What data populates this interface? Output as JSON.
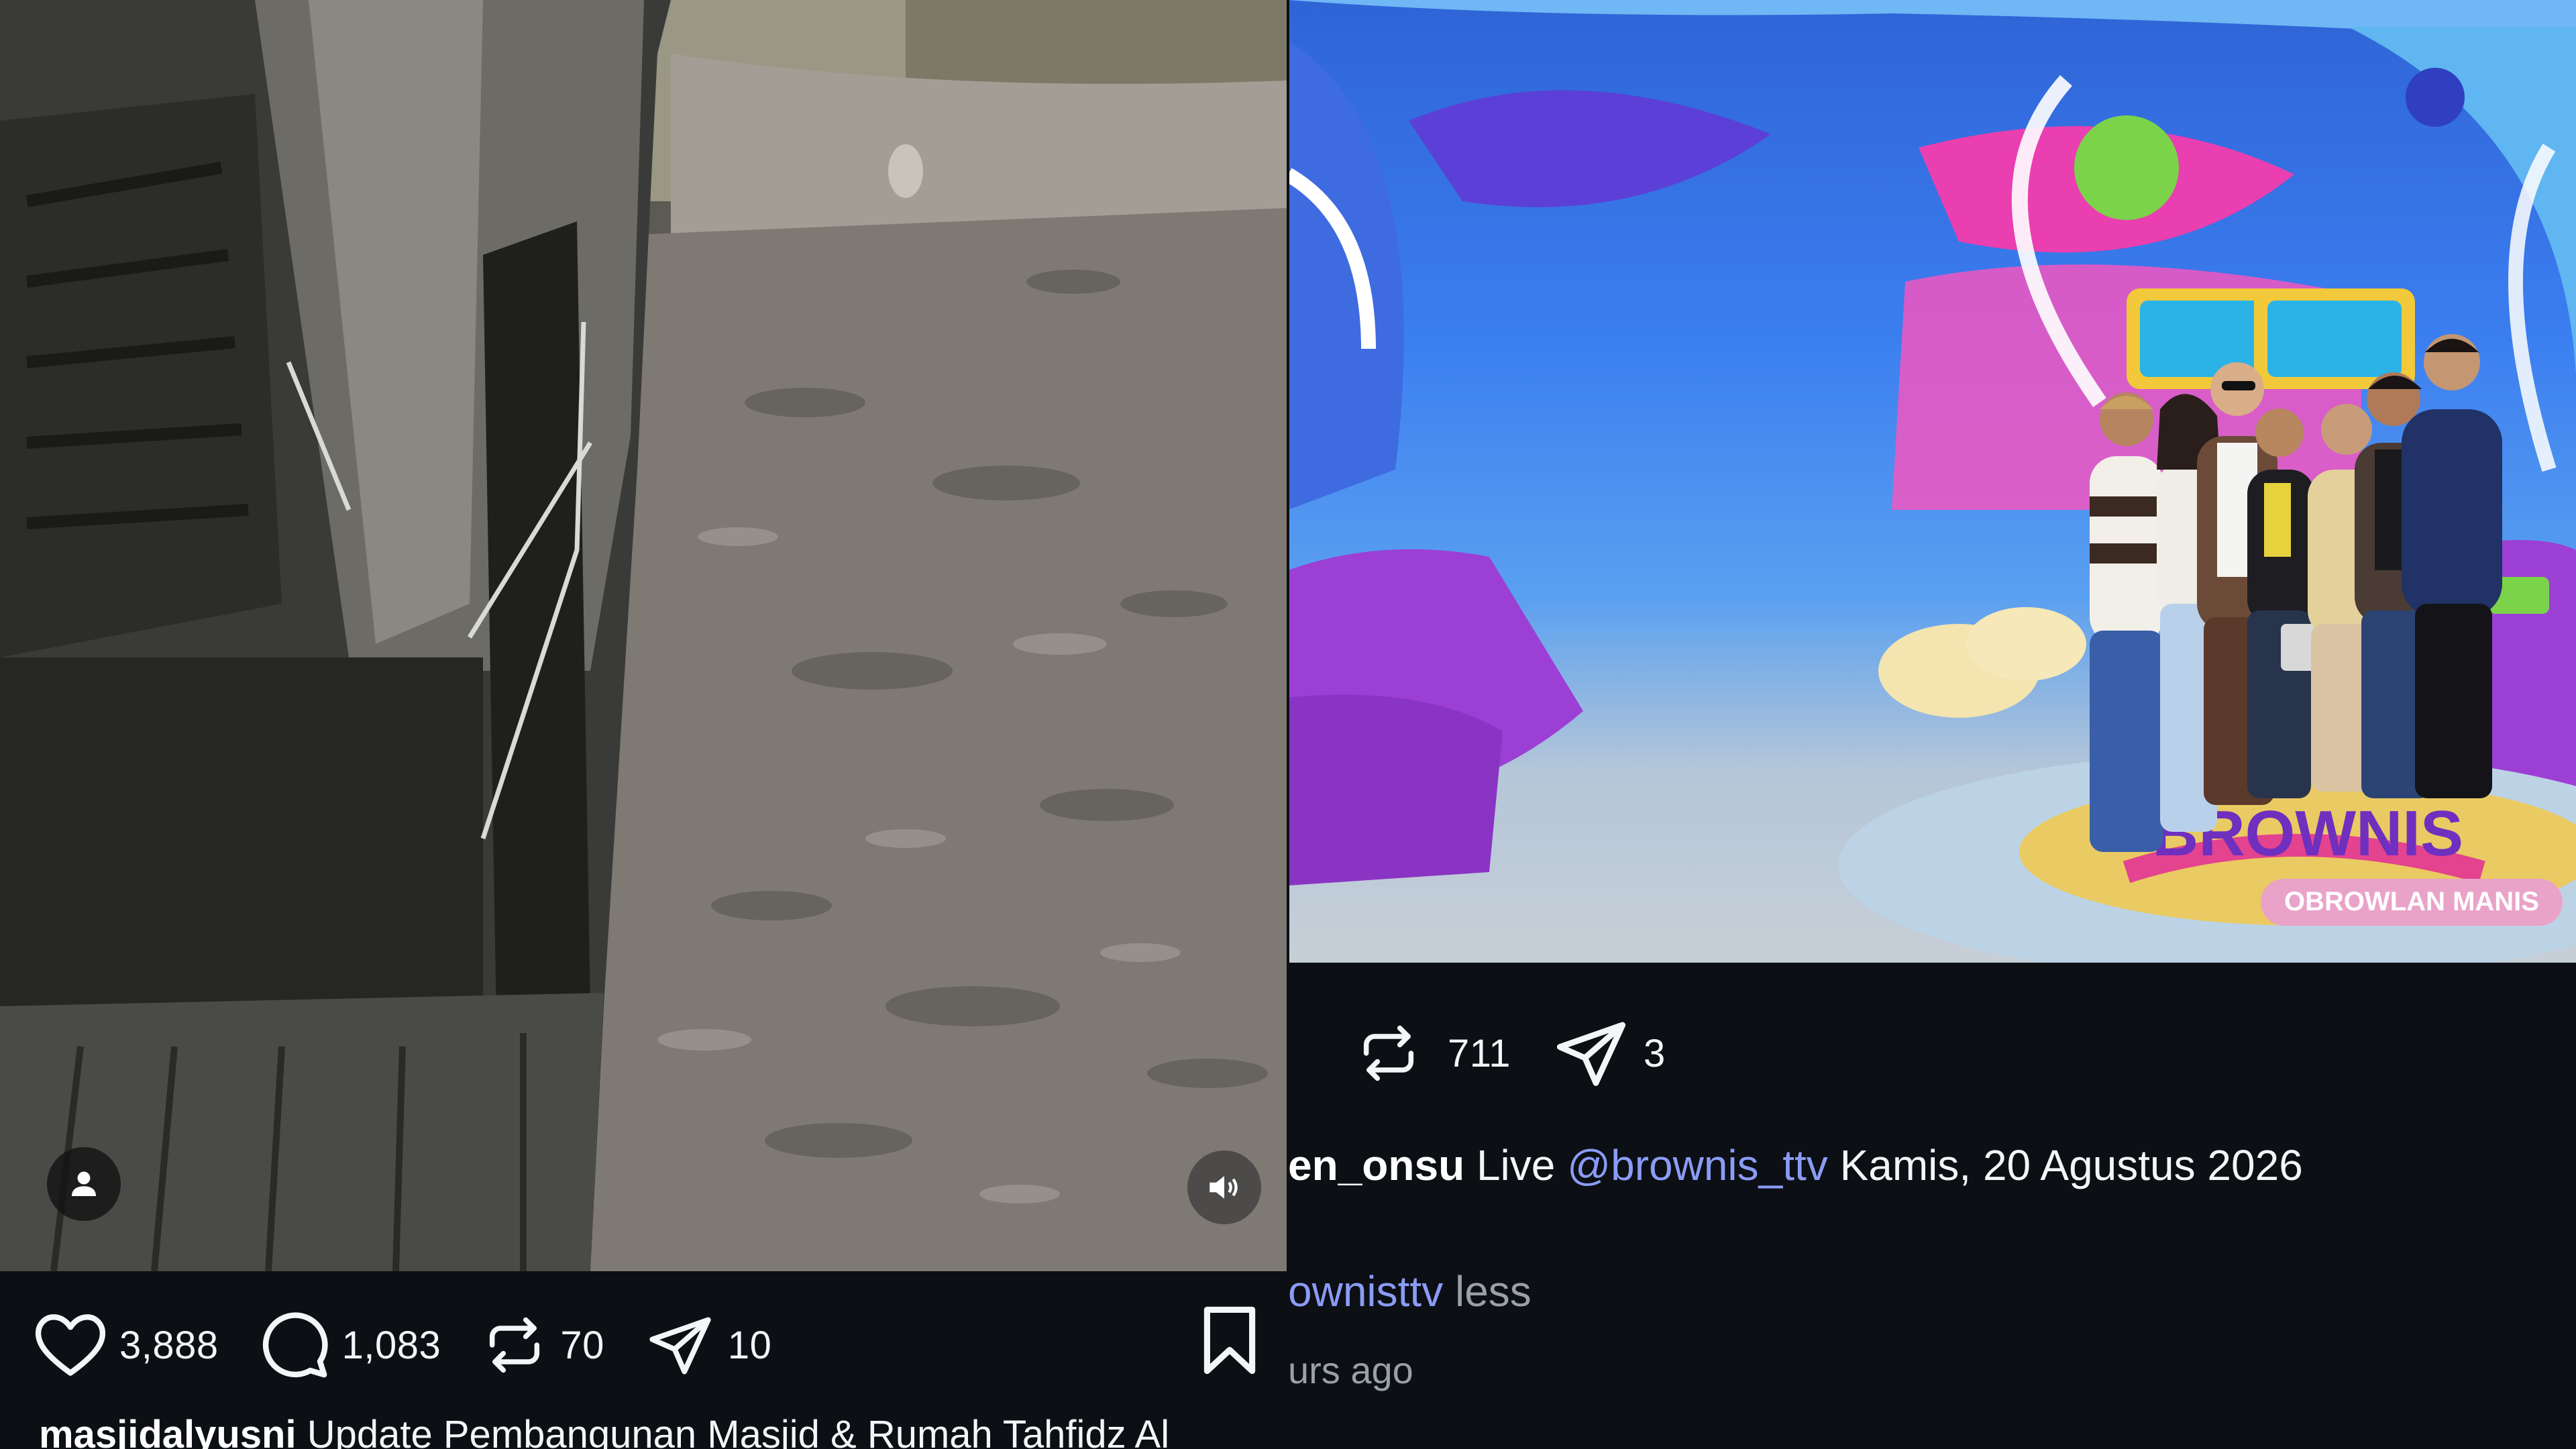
{
  "left_post": {
    "likes": "3,888",
    "comments": "1,083",
    "reposts": "70",
    "shares": "10",
    "username": "masjidalyusni",
    "caption": "Update Pembangunan Masjid & Rumah Tahfidz Al"
  },
  "right_post": {
    "reposts": "711",
    "shares": "3",
    "caption_username": "en_onsu",
    "caption_text_1": "Live",
    "mention": "@brownis_ttv",
    "caption_text_2": "Kamis, 20 Agustus 2026",
    "hashtag_fragment": "ownisttv",
    "less_label": "less",
    "timestamp": "urs ago",
    "set_sign_text": "OBROWLAN MANIS",
    "set_logo_text": "BROWNIS"
  },
  "icons": {
    "like": "heart-icon",
    "comment": "speech-bubble-icon",
    "repost": "repost-arrows-icon",
    "share": "paper-plane-icon",
    "bookmark": "bookmark-icon",
    "avatar": "person-icon",
    "volume": "speaker-icon"
  },
  "colors": {
    "background": "#0c0f14",
    "text": "#f4f5f7",
    "mention": "#8b9bf5",
    "muted": "#9aa0a8"
  }
}
